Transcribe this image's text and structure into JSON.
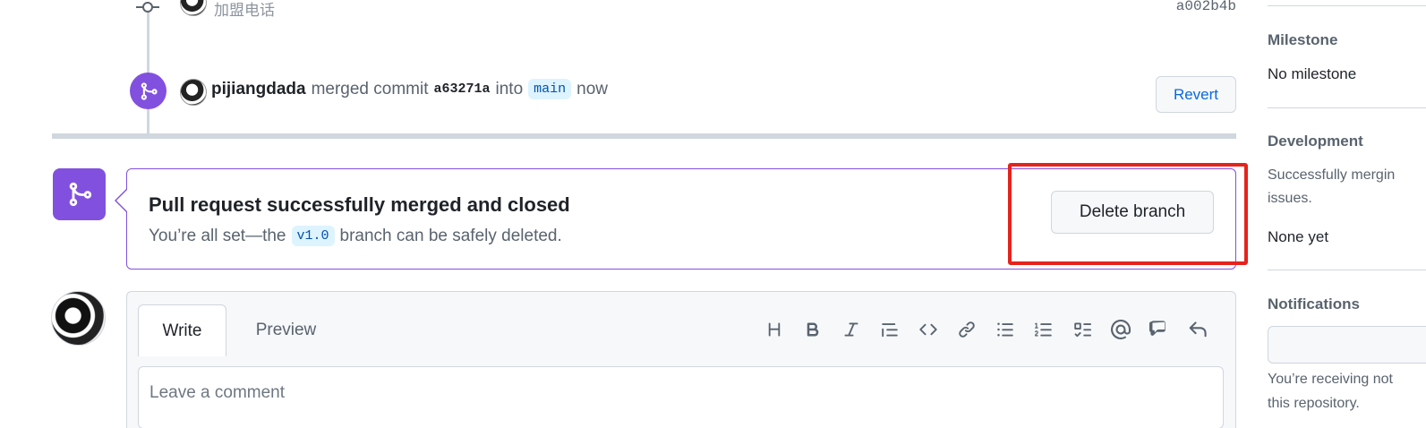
{
  "timeline": {
    "commit": {
      "message": "加盟电话",
      "sha": "a002b4b",
      "icon": "git-commit-icon"
    },
    "merge_event": {
      "actor": "pijiangdada",
      "action": "merged commit",
      "sha": "a63271a",
      "preposition": "into",
      "branch": "main",
      "time": "now",
      "revert_label": "Revert",
      "icon": "git-merge-icon"
    }
  },
  "merge_status": {
    "title": "Pull request successfully merged and closed",
    "desc_prefix": "You’re all set—the",
    "branch": "v1.0",
    "desc_suffix": "branch can be safely deleted.",
    "delete_label": "Delete branch",
    "icon_color": "#8250df"
  },
  "comment": {
    "tabs": [
      "Write",
      "Preview"
    ],
    "placeholder": "Leave a comment",
    "toolbar": [
      "heading-icon",
      "bold-icon",
      "italic-icon",
      "quote-icon",
      "code-icon",
      "link-icon",
      "bulleted-list-icon",
      "numbered-list-icon",
      "task-list-icon",
      "mention-icon",
      "cross-reference-icon",
      "reply-icon"
    ]
  },
  "sidebar": {
    "milestone": {
      "heading": "Milestone",
      "value": "No milestone"
    },
    "development": {
      "heading": "Development",
      "text_line1": "Successfully mergin",
      "text_line2": "issues.",
      "value": "None yet"
    },
    "notifications": {
      "heading": "Notifications",
      "text_line1": "You’re receiving not",
      "text_line2": "this repository."
    }
  },
  "colors": {
    "accent": "#8250df",
    "link": "#0969da",
    "highlight": "#e5231d"
  }
}
